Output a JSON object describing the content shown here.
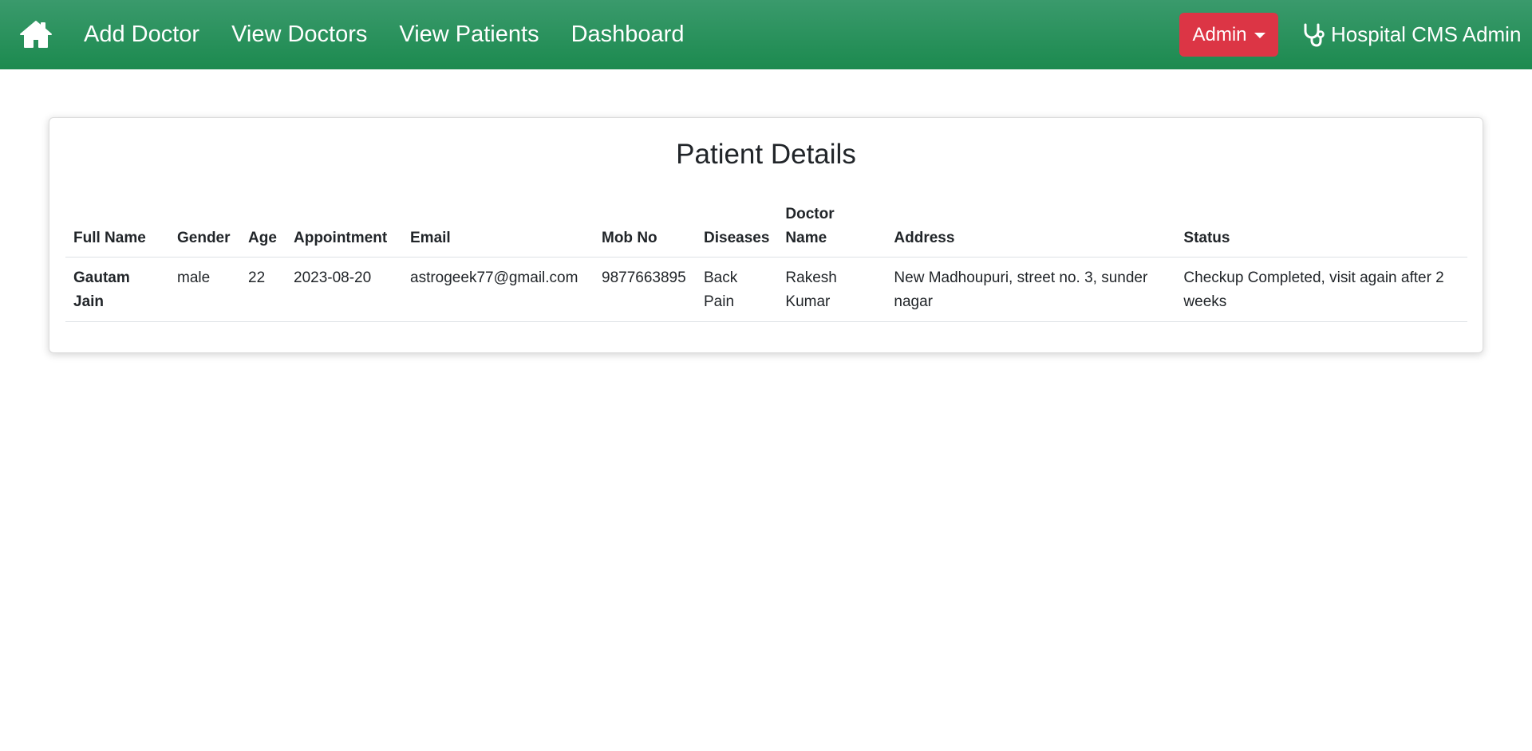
{
  "navbar": {
    "home_icon": "home-icon",
    "links": [
      "Add Doctor",
      "View Doctors",
      "View Patients",
      "Dashboard"
    ],
    "admin_label": "Admin",
    "brand_icon": "stethoscope-icon",
    "brand_label": "Hospital CMS Admin",
    "background_color": "#1c8a4f"
  },
  "card": {
    "title": "Patient Details"
  },
  "table": {
    "headers": [
      "Full Name",
      "Gender",
      "Age",
      "Appointment",
      "Email",
      "Mob No",
      "Diseases",
      "Doctor Name",
      "Address",
      "Status"
    ],
    "rows": [
      {
        "full_name": "Gautam Jain",
        "gender": "male",
        "age": "22",
        "appointment": "2023-08-20",
        "email": "astrogeek77@gmail.com",
        "mob_no": "9877663895",
        "diseases": "Back Pain",
        "doctor_name": "Rakesh Kumar",
        "address": "New Madhoupuri, street no. 3, sunder nagar",
        "status": "Checkup Completed, visit again after 2 weeks"
      }
    ]
  },
  "colors": {
    "admin_button": "#dc3545",
    "text": "#212529"
  }
}
